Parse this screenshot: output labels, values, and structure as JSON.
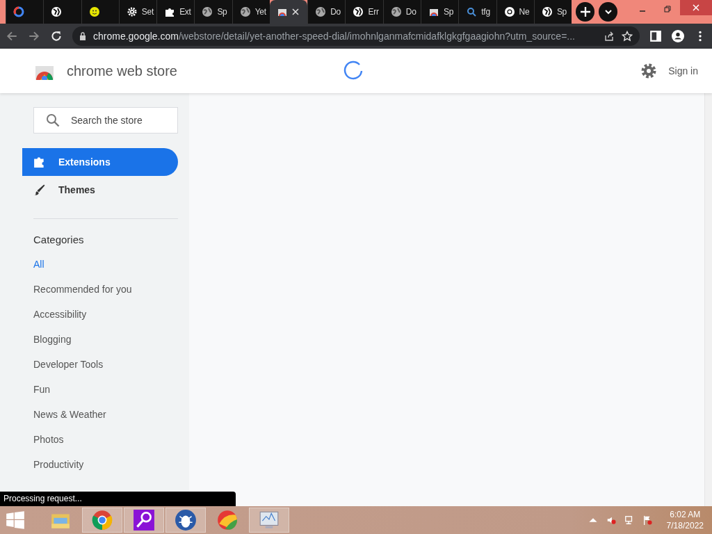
{
  "tabs": [
    {
      "kind": "google",
      "selected": false
    },
    {
      "kind": "globe",
      "selected": false
    },
    {
      "kind": "smiley",
      "selected": false
    },
    {
      "kind": "gear",
      "label": "Set",
      "selected": false
    },
    {
      "kind": "puzzle",
      "label": "Ext",
      "selected": false
    },
    {
      "kind": "earth",
      "label": "Sp",
      "selected": false
    },
    {
      "kind": "earth",
      "label": "Yet",
      "selected": false
    },
    {
      "kind": "store",
      "selected": true
    },
    {
      "kind": "earth",
      "label": "Do",
      "selected": false
    },
    {
      "kind": "globe",
      "label": "Err",
      "selected": false
    },
    {
      "kind": "earth",
      "label": "Do",
      "selected": false
    },
    {
      "kind": "store",
      "label": "Sp",
      "selected": false
    },
    {
      "kind": "search",
      "label": "tfg",
      "selected": false
    },
    {
      "kind": "chrome",
      "label": "Ne",
      "selected": false
    },
    {
      "kind": "globe",
      "label": "Sp",
      "selected": false
    }
  ],
  "address": {
    "host": "chrome.google.com",
    "path": "/webstore/detail/yet-another-speed-dial/imohnlganmafcmidafklgkgfgaagiohn?utm_source=..."
  },
  "store": {
    "title": "chrome web store",
    "sign_in": "Sign in",
    "search_placeholder": "Search the store",
    "nav": [
      {
        "kind": "puzzle",
        "label": "Extensions",
        "selected": true
      },
      {
        "kind": "brush",
        "label": "Themes",
        "selected": false
      }
    ],
    "categories_heading": "Categories",
    "categories": [
      {
        "label": "All",
        "selected": true
      },
      {
        "label": "Recommended for you",
        "selected": false
      },
      {
        "label": "Accessibility",
        "selected": false
      },
      {
        "label": "Blogging",
        "selected": false
      },
      {
        "label": "Developer Tools",
        "selected": false
      },
      {
        "label": "Fun",
        "selected": false
      },
      {
        "label": "News & Weather",
        "selected": false
      },
      {
        "label": "Photos",
        "selected": false
      },
      {
        "label": "Productivity",
        "selected": false
      }
    ]
  },
  "status_bubble": "Processing request...",
  "taskbar": {
    "apps": [
      {
        "kind": "folder",
        "active": false
      },
      {
        "kind": "chrome",
        "active": true
      },
      {
        "kind": "magnifier",
        "active": true
      },
      {
        "kind": "bug",
        "active": true
      },
      {
        "kind": "ball",
        "active": false
      },
      {
        "kind": "monitor",
        "active": true
      }
    ],
    "time": "6:02 AM",
    "date": "7/18/2022"
  }
}
